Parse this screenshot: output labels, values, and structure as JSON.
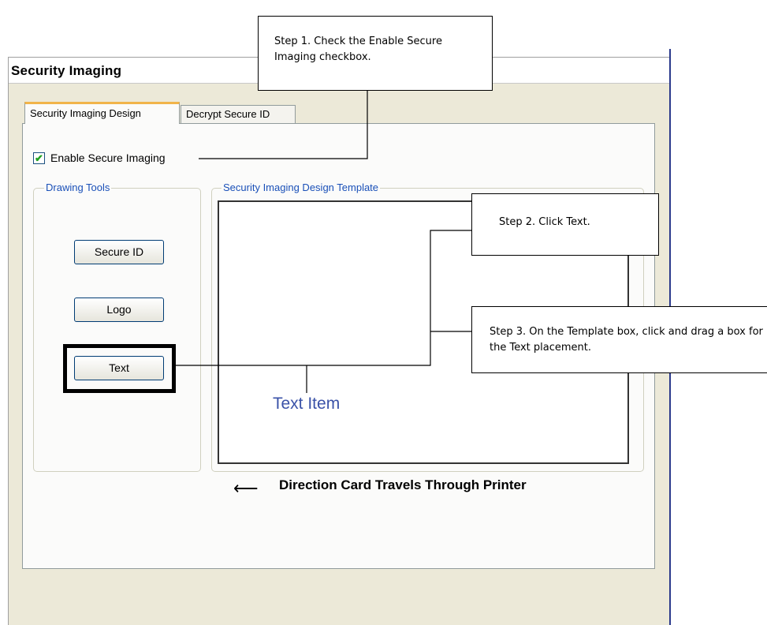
{
  "window": {
    "title": "Security Imaging"
  },
  "tabs": [
    {
      "label": "Security Imaging Design",
      "active": true
    },
    {
      "label": "Decrypt Secure ID",
      "active": false
    }
  ],
  "enable_secure_imaging": {
    "label": "Enable Secure Imaging",
    "checked": true,
    "check_glyph": "✔"
  },
  "drawing_tools": {
    "legend": "Drawing Tools",
    "buttons": [
      {
        "label": "Secure ID"
      },
      {
        "label": "Logo"
      },
      {
        "label": "Text"
      }
    ]
  },
  "template": {
    "legend": "Security Imaging Design Template",
    "text_item": "Text Item"
  },
  "direction": {
    "arrow": "⟵",
    "label": "Direction Card Travels Through Printer"
  },
  "callouts": {
    "step1": "Step 1. Check the Enable Secure Imaging checkbox.",
    "step2": "Step 2. Click Text.",
    "step3": "Step 3. On the Template box, click and drag a box for the Text placement."
  },
  "colors": {
    "panel_bg": "#ece9d8",
    "tab_accent": "#f1b44a",
    "legend_blue": "#1a50b8",
    "text_item_blue": "#3a52a8",
    "window_edge": "#2b3a8c"
  }
}
